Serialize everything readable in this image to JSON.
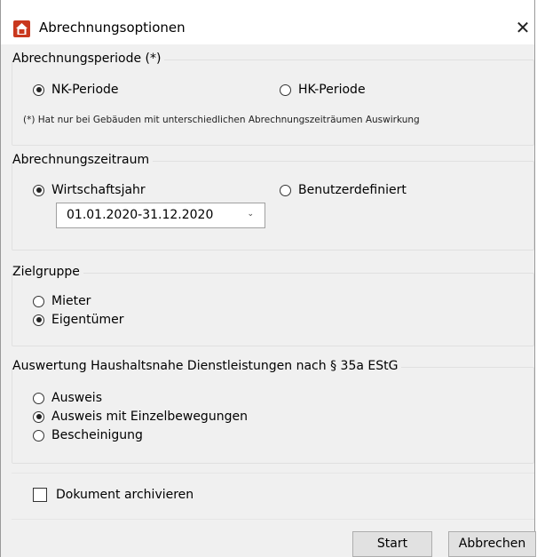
{
  "window": {
    "title": "Abrechnungsoptionen",
    "close_glyph": "✕",
    "icon": "house-icon"
  },
  "periode": {
    "legend": "Abrechnungsperiode (*)",
    "options": [
      {
        "label": "NK-Periode",
        "checked": true
      },
      {
        "label": "HK-Periode",
        "checked": false
      }
    ],
    "note": "(*) Hat nur bei Gebäuden mit unterschiedlichen Abrechnungszeiträumen Auswirkung"
  },
  "zeitraum": {
    "legend": "Abrechnungszeitraum",
    "options": [
      {
        "label": "Wirtschaftsjahr",
        "checked": true
      },
      {
        "label": "Benutzerdefiniert",
        "checked": false
      }
    ],
    "select_value": "01.01.2020-31.12.2020"
  },
  "zielgruppe": {
    "legend": "Zielgruppe",
    "options": [
      {
        "label": "Mieter",
        "checked": false
      },
      {
        "label": "Eigentümer",
        "checked": true
      }
    ]
  },
  "auswertung": {
    "legend": "Auswertung Haushaltsnahe Dienstleistungen nach § 35a EStG",
    "options": [
      {
        "label": "Ausweis",
        "checked": false
      },
      {
        "label": "Ausweis mit Einzelbewegungen",
        "checked": true
      },
      {
        "label": "Bescheinigung",
        "checked": false
      }
    ]
  },
  "archive": {
    "label": "Dokument archivieren",
    "checked": false
  },
  "buttons": {
    "start": "Start",
    "cancel": "Abbrechen"
  }
}
